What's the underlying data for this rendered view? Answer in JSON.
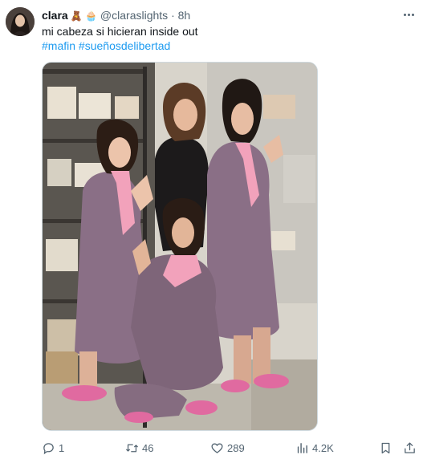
{
  "author": {
    "name": "clara",
    "emojis": "🧸 🧁",
    "handle": "@claraslights",
    "separator": "·",
    "time": "8h"
  },
  "tweet": {
    "text": "mi cabeza si hicieran inside out",
    "hashtags": [
      "#mafin",
      "#sueñosdelibertad"
    ]
  },
  "icons": {
    "avatar": "profile-photo",
    "more": "more-icon",
    "reply": "reply-icon",
    "retweet": "retweet-icon",
    "like": "heart-icon",
    "views": "views-icon",
    "bookmark": "bookmark-icon",
    "share": "share-icon"
  },
  "stats": {
    "replies": "1",
    "retweets": "46",
    "likes": "289",
    "views": "4.2K"
  },
  "colors": {
    "accent": "#1d9bf0",
    "secondary_text": "#536471",
    "suit": "#8a6f86",
    "shoes": "#e06aa0",
    "scarf": "#f2a2bb"
  }
}
